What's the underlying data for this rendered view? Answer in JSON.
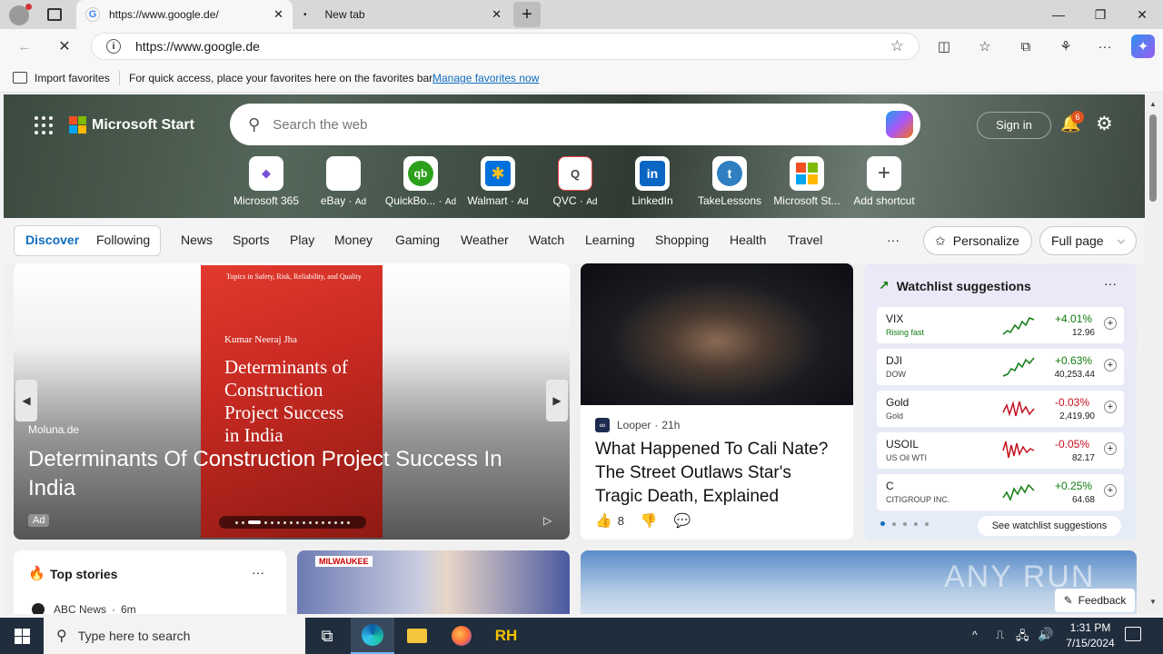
{
  "browser": {
    "tabs": [
      {
        "label": "https://www.google.de/",
        "favicon": "G"
      },
      {
        "label": "New tab"
      }
    ],
    "new_tab_symbol": "+",
    "window_controls": {
      "minimize": "—",
      "maximize": "❐",
      "close": "✕"
    },
    "address": "https://www.google.de",
    "favorites_bar": {
      "import_label": "Import favorites",
      "message": "For quick access, place your favorites here on the favorites bar.",
      "manage_link": "Manage favorites now"
    }
  },
  "msn": {
    "logo_text": "Microsoft Start",
    "search_placeholder": "Search the web",
    "sign_in": "Sign in",
    "notification_count": "6",
    "shortcuts": [
      {
        "label": "Microsoft 365",
        "ad": "",
        "glyph": "◆",
        "color": "#7b4fd6"
      },
      {
        "label": "eBay",
        "ad": "Ad",
        "glyph": "🛍",
        "color": "#e53238"
      },
      {
        "label": "QuickBo...",
        "ad": "Ad",
        "glyph": "qb",
        "color": "#2ca01c"
      },
      {
        "label": "Walmart",
        "ad": "Ad",
        "glyph": "✱",
        "color": "#0071dc"
      },
      {
        "label": "QVC",
        "ad": "Ad",
        "glyph": "Q",
        "color": "#444444"
      },
      {
        "label": "LinkedIn",
        "ad": "",
        "glyph": "in",
        "color": "#0a66c2"
      },
      {
        "label": "TakeLessons",
        "ad": "",
        "glyph": "t",
        "color": "#2f7fc1"
      },
      {
        "label": "Microsoft St...",
        "ad": "",
        "glyph": "▦",
        "color": "#f25022"
      },
      {
        "label": "Add shortcut",
        "ad": "",
        "glyph": "+",
        "color": "#444444"
      }
    ],
    "nav_tabs": [
      "Discover",
      "Following"
    ],
    "nav_items": [
      "News",
      "Sports",
      "Play",
      "Money",
      "Gaming",
      "Weather",
      "Watch",
      "Learning",
      "Shopping",
      "Health",
      "Travel"
    ],
    "more": "···",
    "personalize": "Personalize",
    "full_page": "Full page",
    "hero_card": {
      "source": "Moluna.de",
      "title": "Determinants Of Construction Project Success In India",
      "ad_badge": "Ad",
      "book": {
        "series": "Topics in Safety, Risk, Reliability, and Quality",
        "author": "Kumar Neeraj Jha",
        "title": "Determinants of Construction Project Success in India"
      }
    },
    "story_card": {
      "source": "Looper",
      "age": "21h",
      "title": "What Happened To Cali Nate? The Street Outlaws Star's Tragic Death, Explained",
      "likes": "8"
    },
    "watchlist": {
      "title": "Watchlist suggestions",
      "see_more": "See watchlist suggestions",
      "items": [
        {
          "symbol": "VIX",
          "sub": "Rising fast",
          "change": "+4.01%",
          "price": "12.96",
          "up": true
        },
        {
          "symbol": "DJI",
          "sub": "DOW",
          "change": "+0.63%",
          "price": "40,253.44",
          "up": true
        },
        {
          "symbol": "Gold",
          "sub": "Gold",
          "change": "-0.03%",
          "price": "2,419.90",
          "up": false
        },
        {
          "symbol": "USOIL",
          "sub": "US Oil WTI",
          "change": "-0.05%",
          "price": "82.17",
          "up": false
        },
        {
          "symbol": "C",
          "sub": "CITIGROUP INC.",
          "change": "+0.25%",
          "price": "64.68",
          "up": true
        }
      ]
    },
    "top_stories": {
      "title": "Top stories",
      "first_source": "ABC News",
      "first_age": "6m"
    },
    "live_badge": "MILWAUKEE",
    "feedback": "Feedback",
    "watermark": "ANY RUN"
  },
  "taskbar": {
    "search_placeholder": "Type here to search",
    "time": "1:31 PM",
    "date": "7/15/2024"
  },
  "colors": {
    "accent": "#0f6cbd",
    "up": "#107c10",
    "down": "#c50f1f"
  }
}
